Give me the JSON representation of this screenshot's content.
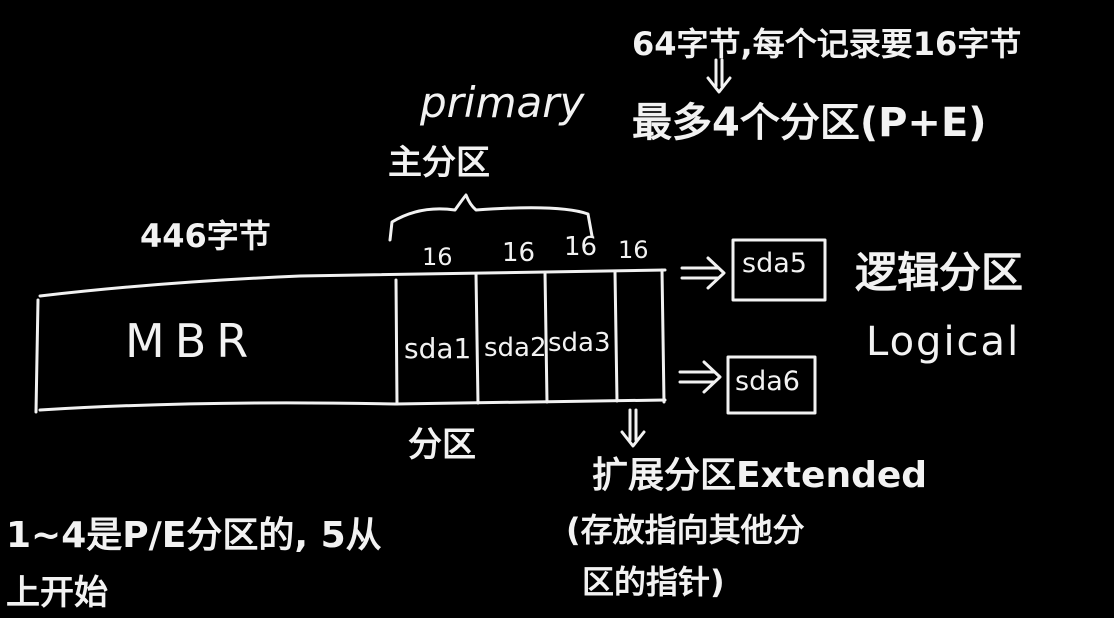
{
  "annotations": {
    "right_note": "64字节,每个记录要16字节",
    "max_partitions": "最多4个分区(P+E)",
    "primary_label": "primary",
    "primary_cn": "主分区",
    "mbr_size": "446字节",
    "mbr_label": "MBR",
    "partition_label": "分区",
    "logical_cn": "逻辑分区",
    "logical_en": "Logical",
    "extended_label": "扩展分区Extended",
    "extended_note_line1": "(存放指向其他分",
    "extended_note_line2": "区的指针)",
    "bottom_note_line1": "1~4是P/E分区的, 5从",
    "bottom_note_line2": "上开始"
  },
  "partition_table": {
    "entry_sizes": [
      "16",
      "16",
      "16",
      "16"
    ],
    "entries": [
      "sda1",
      "sda2",
      "sda3",
      ""
    ]
  },
  "logical_partitions": [
    "sda5",
    "sda6"
  ],
  "colors": {
    "background": "#000000",
    "ink": "#f2f2f2"
  }
}
